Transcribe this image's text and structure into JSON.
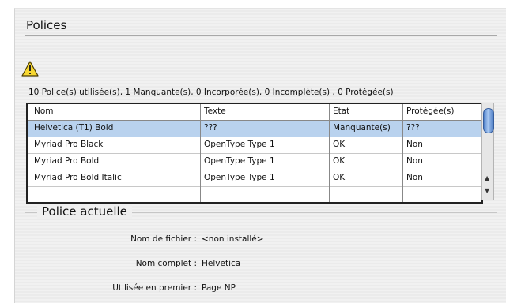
{
  "section": {
    "title": "Polices"
  },
  "summary": "10 Police(s) utilisée(s), 1 Manquante(s), 0 Incorporée(s), 0 Incomplète(s) , 0 Protégée(s)",
  "table": {
    "headers": [
      "Nom",
      "Texte",
      "Etat",
      "Protégée(s)"
    ],
    "rows": [
      [
        "Helvetica (T1) Bold",
        "???",
        "Manquante(s)",
        "???"
      ],
      [
        "Myriad Pro Black",
        "OpenType Type 1",
        "OK",
        "Non"
      ],
      [
        "Myriad Pro Bold",
        "OpenType Type 1",
        "OK",
        "Non"
      ],
      [
        "Myriad Pro Bold Italic",
        "OpenType Type 1",
        "OK",
        "Non"
      ]
    ],
    "selected_row": 0
  },
  "current_font": {
    "title": "Police actuelle",
    "file_label": "Nom de fichier :",
    "file_value": "<non installé>",
    "full_label": "Nom complet :",
    "full_value": "Helvetica",
    "first_label": "Utilisée en premier :",
    "first_value": "Page NP"
  },
  "icons": {
    "warning": "warning-triangle-icon",
    "scroll_up": "arrow-up-icon",
    "scroll_down": "arrow-down-icon"
  },
  "colors": {
    "selection": "#b9d2ee",
    "warning_fill": "#f7d731"
  }
}
